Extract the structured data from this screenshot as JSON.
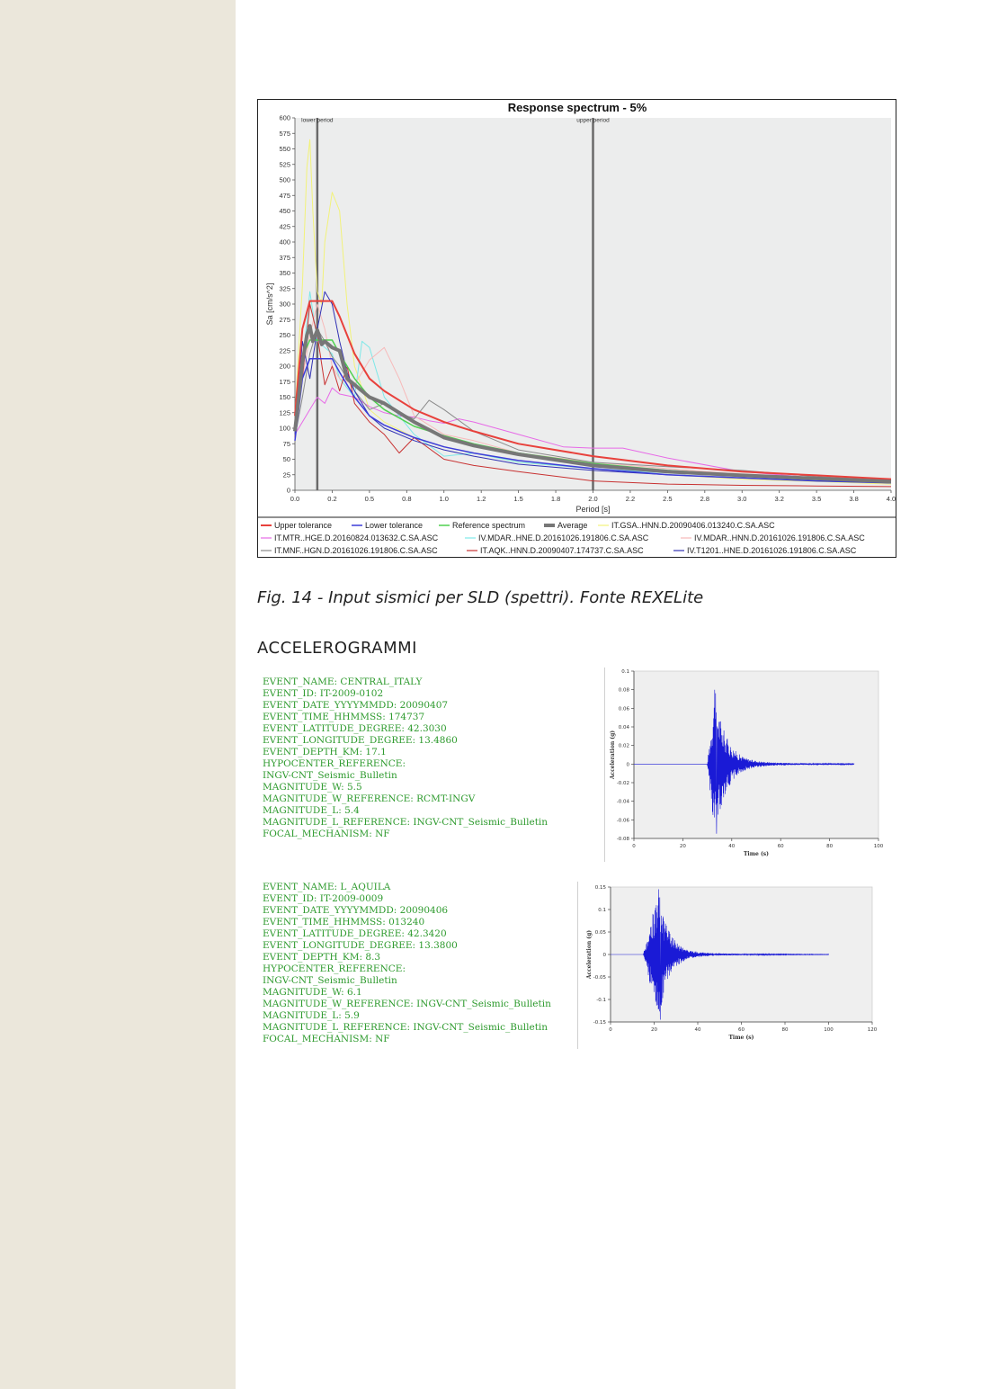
{
  "figure_caption": "Fig. 14 - Input sismici per SLD (spettri). Fonte REXELite",
  "section_heading": "ACCELEROGRAMMI",
  "chart_data": [
    {
      "type": "line",
      "title": "Response spectrum - 5%",
      "xlabel": "Period [s]",
      "ylabel": "Sa [cm/s^2]",
      "xlim": [
        0,
        4.0
      ],
      "ylim": [
        0,
        600
      ],
      "x_ticks": [
        "0.0",
        "0.2",
        "0.5",
        "0.8",
        "1.0",
        "1.2",
        "1.5",
        "1.8",
        "2.0",
        "2.2",
        "2.5",
        "2.8",
        "3.0",
        "3.2",
        "3.5",
        "3.8",
        "4.0"
      ],
      "y_ticks": [
        0,
        25,
        50,
        75,
        100,
        125,
        150,
        175,
        200,
        225,
        250,
        275,
        300,
        325,
        350,
        375,
        400,
        425,
        450,
        475,
        500,
        525,
        550,
        575,
        600
      ],
      "grid": false,
      "legend_position": "bottom",
      "markers": [
        {
          "label": "lower period",
          "x": 0.15
        },
        {
          "label": "upper period",
          "x": 2.0
        }
      ],
      "series": [
        {
          "name": "Upper tolerance",
          "color": "#e8413c",
          "width": 2,
          "x": [
            0,
            0.05,
            0.1,
            0.15,
            0.2,
            0.25,
            0.3,
            0.4,
            0.5,
            0.6,
            0.8,
            1.0,
            1.2,
            1.5,
            2.0,
            2.5,
            3.0,
            3.5,
            4.0
          ],
          "y": [
            120,
            260,
            305,
            305,
            305,
            305,
            280,
            220,
            180,
            160,
            130,
            110,
            95,
            75,
            55,
            40,
            30,
            24,
            18
          ]
        },
        {
          "name": "Lower tolerance",
          "color": "#3c3cd8",
          "width": 1.5,
          "x": [
            0,
            0.05,
            0.1,
            0.15,
            0.2,
            0.25,
            0.3,
            0.4,
            0.5,
            0.6,
            0.8,
            1.0,
            1.2,
            1.5,
            2.0,
            2.5,
            3.0,
            3.5,
            4.0
          ],
          "y": [
            80,
            180,
            212,
            212,
            212,
            212,
            190,
            150,
            120,
            105,
            85,
            70,
            60,
            48,
            35,
            25,
            20,
            15,
            12
          ]
        },
        {
          "name": "Reference spectrum",
          "color": "#4fd14f",
          "width": 1.5,
          "x": [
            0,
            0.05,
            0.1,
            0.15,
            0.2,
            0.25,
            0.3,
            0.4,
            0.5,
            0.6,
            0.8,
            1.0,
            1.2,
            1.5,
            2.0,
            2.5,
            3.0,
            3.5,
            4.0
          ],
          "y": [
            100,
            215,
            242,
            242,
            242,
            242,
            220,
            180,
            150,
            130,
            103,
            88,
            75,
            60,
            43,
            32,
            25,
            20,
            15
          ]
        },
        {
          "name": "Average",
          "color": "#777777",
          "width": 4,
          "x": [
            0,
            0.05,
            0.08,
            0.1,
            0.12,
            0.15,
            0.18,
            0.2,
            0.25,
            0.3,
            0.35,
            0.4,
            0.5,
            0.6,
            0.7,
            0.8,
            1.0,
            1.2,
            1.5,
            2.0,
            2.5,
            3.0,
            3.5,
            4.0
          ],
          "y": [
            95,
            205,
            250,
            265,
            240,
            258,
            235,
            240,
            230,
            225,
            180,
            170,
            150,
            140,
            125,
            110,
            85,
            72,
            58,
            40,
            30,
            24,
            19,
            14
          ]
        },
        {
          "name": "IT.GSA..HNN.D.20090406.013240.C.SA.ASC",
          "color": "#f2f27a",
          "width": 1,
          "x": [
            0,
            0.05,
            0.08,
            0.1,
            0.12,
            0.15,
            0.18,
            0.2,
            0.25,
            0.3,
            0.35,
            0.4,
            0.5,
            0.6,
            0.8,
            1.0,
            1.2,
            1.5,
            2.0,
            2.5,
            3.0,
            3.5,
            4.0
          ],
          "y": [
            120,
            330,
            520,
            565,
            450,
            320,
            300,
            400,
            480,
            450,
            300,
            200,
            130,
            110,
            85,
            70,
            60,
            45,
            35,
            25,
            18,
            14,
            10
          ]
        },
        {
          "name": "IT.MTR..HGE.D.20160824.013632.C.SA.ASC",
          "color": "#e76ae7",
          "width": 1,
          "x": [
            0,
            0.05,
            0.1,
            0.15,
            0.2,
            0.25,
            0.3,
            0.4,
            0.5,
            0.6,
            0.7,
            0.8,
            0.9,
            1.0,
            1.1,
            1.2,
            1.5,
            1.8,
            2.0,
            2.2,
            2.5,
            3.0,
            3.5,
            4.0
          ],
          "y": [
            90,
            110,
            130,
            150,
            140,
            165,
            155,
            150,
            135,
            125,
            120,
            118,
            112,
            108,
            115,
            110,
            90,
            70,
            68,
            68,
            52,
            30,
            20,
            15
          ]
        },
        {
          "name": "IV.MDAR..HNE.D.20161026.191806.C.SA.ASC",
          "color": "#7ee8e8",
          "width": 1,
          "x": [
            0,
            0.05,
            0.1,
            0.15,
            0.2,
            0.25,
            0.3,
            0.4,
            0.45,
            0.5,
            0.6,
            0.8,
            1.0,
            1.2,
            1.5,
            2.0,
            2.5,
            3.0,
            3.5,
            4.0
          ],
          "y": [
            95,
            200,
            320,
            240,
            230,
            220,
            180,
            150,
            240,
            230,
            150,
            90,
            55,
            60,
            45,
            35,
            28,
            22,
            16,
            12
          ]
        },
        {
          "name": "IV.MDAR..HNN.D.20161026.191806.C.SA.ASC",
          "color": "#f7b9b9",
          "width": 1,
          "x": [
            0,
            0.05,
            0.1,
            0.15,
            0.2,
            0.25,
            0.3,
            0.4,
            0.5,
            0.6,
            0.7,
            0.8,
            1.0,
            1.2,
            1.5,
            2.0,
            2.5,
            3.0,
            3.5,
            4.0
          ],
          "y": [
            95,
            180,
            250,
            300,
            260,
            200,
            180,
            170,
            210,
            230,
            180,
            120,
            90,
            80,
            60,
            45,
            35,
            26,
            20,
            15
          ]
        },
        {
          "name": "IT.MNF..HGN.D.20161026.191806.C.SA.ASC",
          "color": "#8a8a8a",
          "width": 1,
          "x": [
            0,
            0.05,
            0.1,
            0.15,
            0.2,
            0.25,
            0.3,
            0.4,
            0.5,
            0.6,
            0.7,
            0.8,
            0.9,
            1.0,
            1.2,
            1.5,
            2.0,
            2.5,
            3.0,
            3.5,
            4.0
          ],
          "y": [
            85,
            150,
            220,
            260,
            240,
            215,
            200,
            160,
            130,
            140,
            125,
            115,
            145,
            130,
            95,
            65,
            45,
            38,
            32,
            22,
            16
          ]
        },
        {
          "name": "IT.AQK..HNN.D.20090407.174737.C.SA.ASC",
          "color": "#c83232",
          "width": 1,
          "x": [
            0,
            0.05,
            0.1,
            0.15,
            0.2,
            0.25,
            0.3,
            0.35,
            0.4,
            0.5,
            0.6,
            0.7,
            0.8,
            1.0,
            1.2,
            1.5,
            2.0,
            2.5,
            3.0,
            3.5,
            4.0
          ],
          "y": [
            85,
            180,
            300,
            250,
            170,
            200,
            160,
            200,
            140,
            110,
            90,
            60,
            85,
            50,
            40,
            30,
            15,
            10,
            8,
            7,
            6
          ]
        },
        {
          "name": "IV.T1201..HNE.D.20161026.191806.C.SA.ASC",
          "color": "#3232b4",
          "width": 1,
          "x": [
            0,
            0.05,
            0.1,
            0.15,
            0.2,
            0.25,
            0.3,
            0.35,
            0.4,
            0.5,
            0.6,
            0.8,
            1.0,
            1.2,
            1.5,
            2.0,
            2.5,
            3.0,
            3.5,
            4.0
          ],
          "y": [
            90,
            240,
            180,
            260,
            320,
            300,
            240,
            190,
            160,
            120,
            100,
            80,
            65,
            55,
            42,
            32,
            25,
            20,
            15,
            12
          ]
        }
      ]
    },
    {
      "type": "line",
      "xlabel": "Time (s)",
      "ylabel": "Acceleration (g)",
      "xlim": [
        0,
        100
      ],
      "ylim": [
        -0.08,
        0.1
      ],
      "x_ticks": [
        "0",
        "20",
        "40",
        "60",
        "80",
        "100"
      ],
      "y_ticks": [
        "0.1",
        "0.08",
        "0.06",
        "0.04",
        "0.02",
        "0",
        "-0.02",
        "-0.04",
        "-0.06",
        "-0.08"
      ],
      "series_color": "#1a1ad6",
      "record_end": 90,
      "strong_motion_start": 30,
      "peak_time": 33,
      "peak_positive": 0.08,
      "peak_negative": -0.075
    },
    {
      "type": "line",
      "xlabel": "Time (s)",
      "ylabel": "Acceleration (g)",
      "xlim": [
        0,
        120
      ],
      "ylim": [
        -0.15,
        0.15
      ],
      "x_ticks": [
        "0",
        "20",
        "40",
        "60",
        "80",
        "100",
        "120"
      ],
      "y_ticks": [
        "0.15",
        "0.1",
        "0.05",
        "0",
        "-0.05",
        "-0.1",
        "-0.15"
      ],
      "series_color": "#1a1ad6",
      "record_end": 100,
      "strong_motion_start": 15,
      "peak_time": 22,
      "peak_positive": 0.145,
      "peak_negative": -0.145
    }
  ],
  "events": [
    {
      "lines": [
        "EVENT_NAME: CENTRAL_ITALY",
        "EVENT_ID: IT-2009-0102",
        "EVENT_DATE_YYYYMMDD: 20090407",
        "EVENT_TIME_HHMMSS: 174737",
        "EVENT_LATITUDE_DEGREE: 42.3030",
        "EVENT_LONGITUDE_DEGREE: 13.4860",
        "EVENT_DEPTH_KM: 17.1",
        "HYPOCENTER_REFERENCE:",
        "INGV-CNT_Seismic_Bulletin",
        "MAGNITUDE_W: 5.5",
        "MAGNITUDE_W_REFERENCE: RCMT-INGV",
        "MAGNITUDE_L: 5.4",
        "MAGNITUDE_L_REFERENCE: INGV-CNT_Seismic_Bulletin",
        "FOCAL_MECHANISM: NF"
      ]
    },
    {
      "lines": [
        "EVENT_NAME: L_AQUILA",
        "EVENT_ID: IT-2009-0009",
        "EVENT_DATE_YYYYMMDD: 20090406",
        "EVENT_TIME_HHMMSS: 013240",
        "EVENT_LATITUDE_DEGREE: 42.3420",
        "EVENT_LONGITUDE_DEGREE: 13.3800",
        "EVENT_DEPTH_KM: 8.3",
        "HYPOCENTER_REFERENCE:",
        "INGV-CNT_Seismic_Bulletin",
        "MAGNITUDE_W: 6.1",
        "MAGNITUDE_W_REFERENCE: INGV-CNT_Seismic_Bulletin",
        "MAGNITUDE_L: 5.9",
        "MAGNITUDE_L_REFERENCE: INGV-CNT_Seismic_Bulletin",
        "FOCAL_MECHANISM: NF"
      ]
    }
  ]
}
